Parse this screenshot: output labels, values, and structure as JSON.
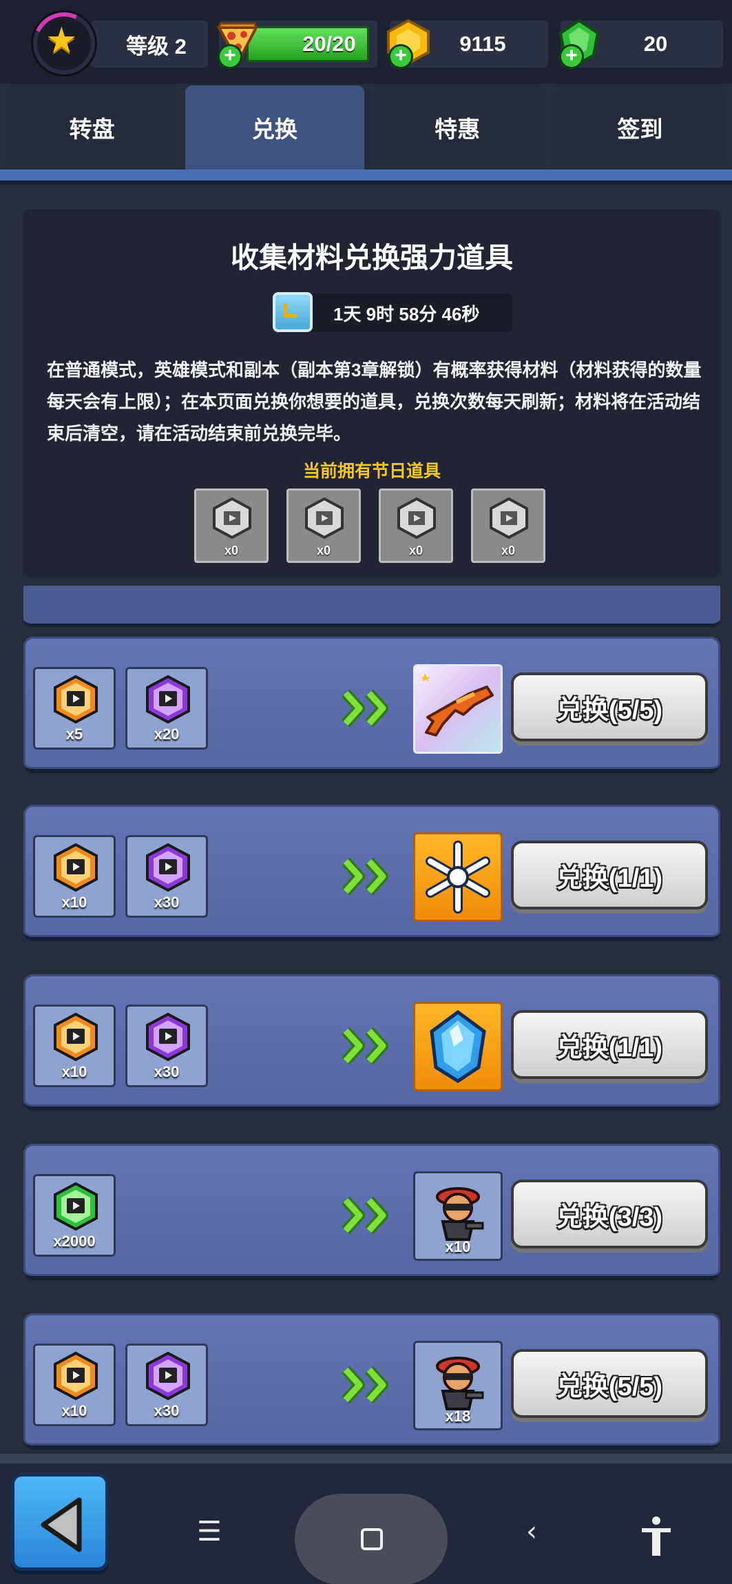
{
  "topbar": {
    "level_label": "等级 2",
    "energy": "20/20",
    "coins": "9115",
    "gems": "20"
  },
  "tabs": [
    {
      "label": "转盘",
      "active": false
    },
    {
      "label": "兑换",
      "active": true
    },
    {
      "label": "特惠",
      "active": false
    },
    {
      "label": "签到",
      "active": false
    }
  ],
  "info": {
    "title": "收集材料兑换强力道具",
    "timer": "1天 9时 58分 46秒",
    "description": "在普通模式，英雄模式和副本（副本第3章解锁）有概率获得材料（材料获得的数量每天会有上限）；在本页面兑换你想要的道具，兑换次数每天刷新；材料将在活动结束后清空，请在活动结束前兑换完毕。",
    "owned_label": "当前拥有节日道具",
    "owned_counts": [
      "x0",
      "x0",
      "x0",
      "x0"
    ]
  },
  "exchanges": [
    {
      "materials": [
        {
          "color": "orange",
          "count": "x5"
        },
        {
          "color": "purple",
          "count": "x20"
        }
      ],
      "reward": "gun",
      "reward_count": "",
      "button": "兑换(5/5)"
    },
    {
      "materials": [
        {
          "color": "orange",
          "count": "x10"
        },
        {
          "color": "purple",
          "count": "x30"
        }
      ],
      "reward": "snowflake",
      "reward_count": "",
      "button": "兑换(1/1)"
    },
    {
      "materials": [
        {
          "color": "orange",
          "count": "x10"
        },
        {
          "color": "purple",
          "count": "x30"
        }
      ],
      "reward": "crystal",
      "reward_count": "",
      "button": "兑换(1/1)"
    },
    {
      "materials": [
        {
          "color": "green",
          "count": "x2000"
        }
      ],
      "reward": "hero-shard",
      "reward_count": "x10",
      "button": "兑换(3/3)"
    },
    {
      "materials": [
        {
          "color": "orange",
          "count": "x10"
        },
        {
          "color": "purple",
          "count": "x30"
        }
      ],
      "reward": "hero-shard",
      "reward_count": "x18",
      "button": "兑换(5/5)"
    }
  ],
  "colors": {
    "orange_hex": "#f08a1c",
    "purple_hex": "#8b3ad8",
    "green_hex": "#2fbf3a",
    "tab_active": "#3d5480",
    "row_bg": "#5a6caa"
  },
  "icons": {
    "back": "triangle-left-icon",
    "menu": "hamburger-icon",
    "home": "square-icon",
    "nav_back": "chevron-left-icon",
    "accessibility": "accessibility-icon"
  }
}
